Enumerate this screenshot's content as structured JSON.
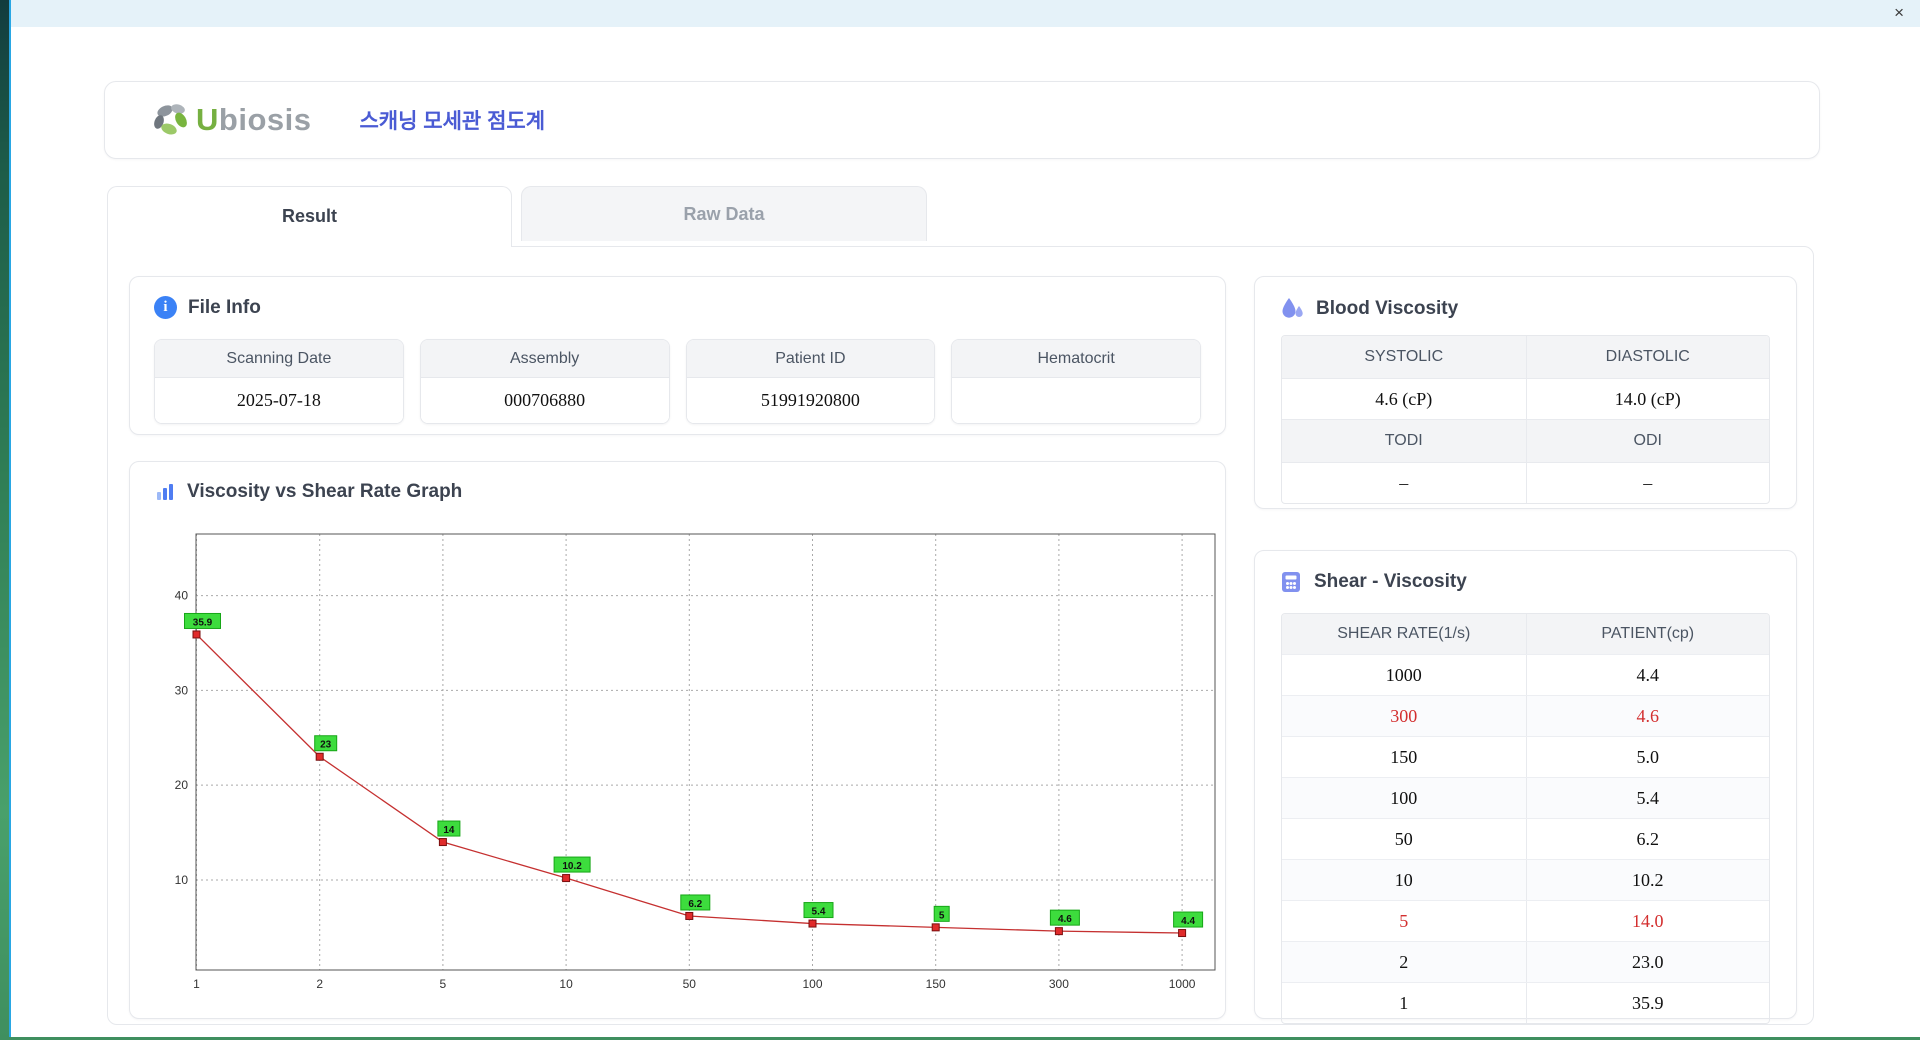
{
  "window": {
    "close_icon": "×"
  },
  "header": {
    "logo_u": "U",
    "logo_rest": "biosis",
    "title": "스캐닝 모세관 점도계"
  },
  "tabs": [
    {
      "label": "Result",
      "active": true
    },
    {
      "label": "Raw Data",
      "active": false
    }
  ],
  "icons": {
    "info_glyph": "i"
  },
  "file_info": {
    "title": "File Info",
    "fields": [
      {
        "label": "Scanning Date",
        "value": "2025-07-18"
      },
      {
        "label": "Assembly",
        "value": "000706880"
      },
      {
        "label": "Patient ID",
        "value": "51991920800"
      },
      {
        "label": "Hematocrit",
        "value": ""
      }
    ]
  },
  "graph": {
    "title": "Viscosity vs Shear Rate Graph"
  },
  "chart_data": {
    "type": "line",
    "title": "Viscosity vs Shear Rate Graph",
    "x_axis": "shear rate (1/s), log-spaced values shown as equally spaced categories",
    "categories": [
      "1",
      "2",
      "5",
      "10",
      "50",
      "100",
      "150",
      "300",
      "1000"
    ],
    "x": [
      1,
      2,
      5,
      10,
      50,
      100,
      150,
      300,
      1000
    ],
    "values": [
      35.9,
      23,
      14,
      10.2,
      6.2,
      5.4,
      5,
      4.6,
      4.4
    ],
    "point_labels": [
      "35.9",
      "23",
      "14",
      "10.2",
      "6.2",
      "5.4",
      "5",
      "4.6",
      "4.4"
    ],
    "xlabel": "",
    "ylabel": "",
    "y_ticks": [
      10,
      20,
      30,
      40
    ],
    "ylim": [
      0.5,
      46.5
    ],
    "grid": true,
    "legend": "none",
    "line_color": "#c53030",
    "marker_color": "#e02b2b",
    "marker_border": "#7a0f0f",
    "label_bg": "#3ddc3d",
    "label_border": "#17a617"
  },
  "blood_viscosity": {
    "title": "Blood Viscosity",
    "sections": [
      {
        "headers": [
          "SYSTOLIC",
          "DIASTOLIC"
        ],
        "values": [
          "4.6 (cP)",
          "14.0 (cP)"
        ]
      },
      {
        "headers": [
          "TODI",
          "ODI"
        ],
        "values": [
          "–",
          "–"
        ]
      }
    ]
  },
  "shear_viscosity": {
    "title": "Shear - Viscosity",
    "columns": [
      "SHEAR RATE(1/s)",
      "PATIENT(cp)"
    ],
    "rows": [
      {
        "shear_rate": "1000",
        "patient": "4.4",
        "highlight": false
      },
      {
        "shear_rate": "300",
        "patient": "4.6",
        "highlight": true
      },
      {
        "shear_rate": "150",
        "patient": "5.0",
        "highlight": false
      },
      {
        "shear_rate": "100",
        "patient": "5.4",
        "highlight": false
      },
      {
        "shear_rate": "50",
        "patient": "6.2",
        "highlight": false
      },
      {
        "shear_rate": "10",
        "patient": "10.2",
        "highlight": false
      },
      {
        "shear_rate": "5",
        "patient": "14.0",
        "highlight": true
      },
      {
        "shear_rate": "2",
        "patient": "23.0",
        "highlight": false
      },
      {
        "shear_rate": "1",
        "patient": "35.9",
        "highlight": false
      }
    ]
  }
}
